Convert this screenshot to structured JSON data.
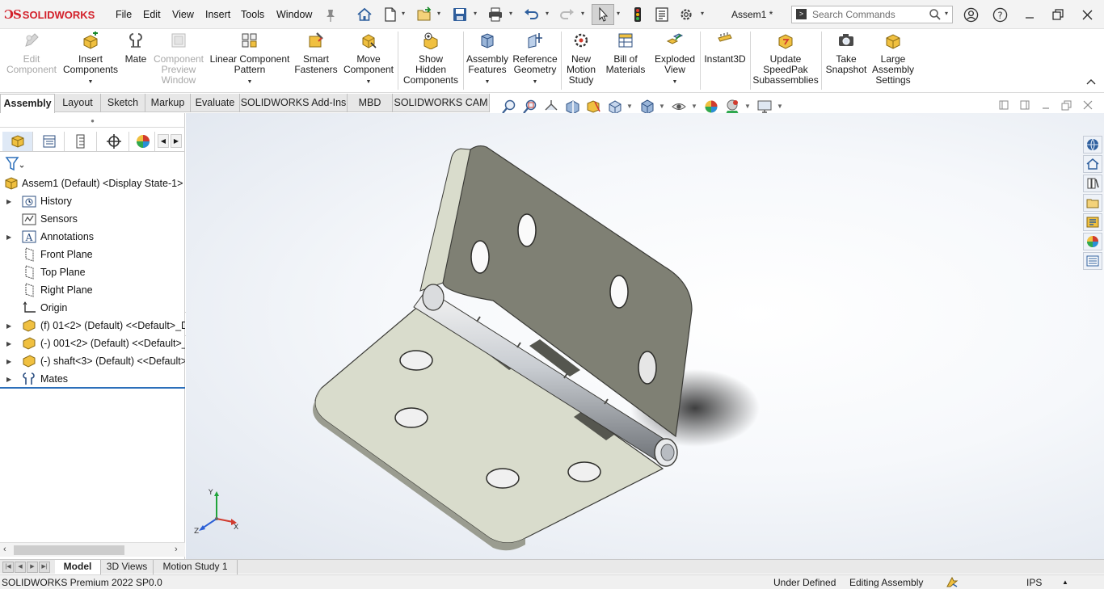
{
  "app": {
    "brand": "SOLIDWORKS",
    "document_title": "Assem1 *",
    "accent": "#d3202a"
  },
  "menubar": {
    "items": [
      "File",
      "Edit",
      "View",
      "Insert",
      "Tools",
      "Window"
    ]
  },
  "search": {
    "placeholder": "Search Commands"
  },
  "ribbon": {
    "buttons": [
      {
        "label": "Edit\nComponent",
        "icon": "edit-component-icon",
        "enabled": false
      },
      {
        "label": "Insert\nComponents",
        "icon": "insert-components-icon",
        "enabled": true
      },
      {
        "label": "Mate",
        "icon": "mate-icon",
        "enabled": true
      },
      {
        "label": "Component\nPreview\nWindow",
        "icon": "component-preview-icon",
        "enabled": false
      },
      {
        "label": "Linear Component\nPattern",
        "icon": "linear-pattern-icon",
        "enabled": true
      },
      {
        "label": "Smart\nFasteners",
        "icon": "smart-fasteners-icon",
        "enabled": true
      },
      {
        "label": "Move\nComponent",
        "icon": "move-component-icon",
        "enabled": true
      },
      {
        "label": "Show\nHidden\nComponents",
        "icon": "show-hidden-icon",
        "enabled": true
      },
      {
        "label": "Assembly\nFeatures",
        "icon": "assembly-features-icon",
        "enabled": true
      },
      {
        "label": "Reference\nGeometry",
        "icon": "reference-geometry-icon",
        "enabled": true
      },
      {
        "label": "New\nMotion\nStudy",
        "icon": "motion-study-icon",
        "enabled": true
      },
      {
        "label": "Bill of\nMaterials",
        "icon": "bom-icon",
        "enabled": true
      },
      {
        "label": "Exploded\nView",
        "icon": "exploded-view-icon",
        "enabled": true
      },
      {
        "label": "Instant3D",
        "icon": "instant3d-icon",
        "enabled": true
      },
      {
        "label": "Update\nSpeedPak\nSubassemblies",
        "icon": "speedpak-icon",
        "enabled": true
      },
      {
        "label": "Take\nSnapshot",
        "icon": "camera-icon",
        "enabled": true
      },
      {
        "label": "Large\nAssembly\nSettings",
        "icon": "large-assembly-icon",
        "enabled": true
      }
    ]
  },
  "command_tabs": [
    "Assembly",
    "Layout",
    "Sketch",
    "Markup",
    "Evaluate",
    "SOLIDWORKS Add-Ins",
    "MBD",
    "SOLIDWORKS CAM"
  ],
  "active_command_tab": "Assembly",
  "feature_tree": {
    "root": "Assem1 (Default) <Display State-1>",
    "items": [
      {
        "label": "History",
        "icon": "history-folder-icon",
        "expandable": true
      },
      {
        "label": "Sensors",
        "icon": "sensors-icon",
        "expandable": false
      },
      {
        "label": "Annotations",
        "icon": "annotations-icon",
        "expandable": true
      },
      {
        "label": "Front Plane",
        "icon": "plane-icon",
        "expandable": false
      },
      {
        "label": "Top Plane",
        "icon": "plane-icon",
        "expandable": false
      },
      {
        "label": "Right Plane",
        "icon": "plane-icon",
        "expandable": false
      },
      {
        "label": "Origin",
        "icon": "origin-icon",
        "expandable": false
      },
      {
        "label": "(f) 01<2> (Default) <<Default>_D",
        "icon": "part-icon",
        "expandable": true
      },
      {
        "label": "(-) 001<2> (Default) <<Default>_I",
        "icon": "part-icon",
        "expandable": true
      },
      {
        "label": "(-) shaft<3> (Default) <<Default>",
        "icon": "part-icon",
        "expandable": true
      },
      {
        "label": "Mates",
        "icon": "mates-icon",
        "expandable": true
      }
    ]
  },
  "triad": {
    "x": "X",
    "y": "Y",
    "z": "Z"
  },
  "bottom_tabs": [
    "Model",
    "3D Views",
    "Motion Study 1"
  ],
  "active_bottom_tab": "Model",
  "status": {
    "product": "SOLIDWORKS Premium 2022 SP0.0",
    "definition": "Under Defined",
    "mode": "Editing Assembly",
    "units": "IPS"
  }
}
